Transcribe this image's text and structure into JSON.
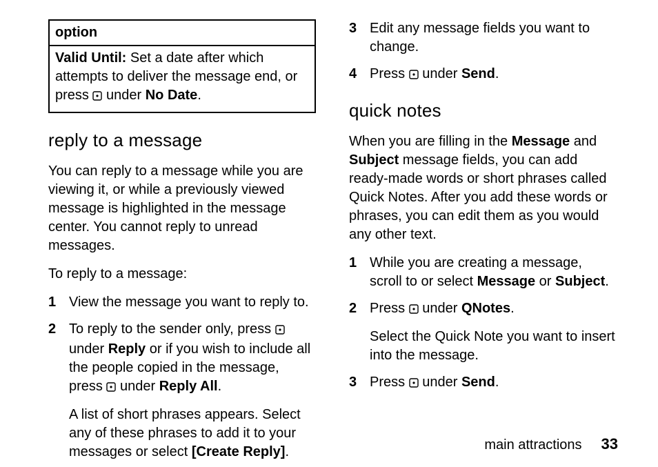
{
  "option": {
    "header": "option",
    "body_label": "Valid Until:",
    "body_text1": " Set a date after which attempts to deliver the message end, or press ",
    "body_text2": " under ",
    "body_nodate": "No Date",
    "body_period": "."
  },
  "left": {
    "heading_reply": "reply to a message",
    "reply_intro": "You can reply to a message while you are viewing it, or while a previously viewed message is highlighted in the message center. You cannot reply to unread messages.",
    "reply_lead": "To reply to a message:",
    "step1_num": "1",
    "step1_text": "View the message you want to reply to.",
    "step2_num": "2",
    "step2_a": "To reply to the sender only, press ",
    "step2_b": " under ",
    "step2_reply": "Reply",
    "step2_c": " or if you wish to include all the people copied in the message, press ",
    "step2_d": " under ",
    "step2_replyall": "Reply All",
    "step2_period": ".",
    "step2_para2a": "A list of short phrases appears. Select any of these phrases to add it to your messages or select ",
    "step2_create": "[Create Reply]",
    "step2_para2b": "."
  },
  "right": {
    "step3_num": "3",
    "step3_text": "Edit any message fields you want to change.",
    "step4_num": "4",
    "step4_a": "Press ",
    "step4_b": " under ",
    "step4_send": "Send",
    "step4_period": ".",
    "heading_quicknotes": "quick notes",
    "qn_intro_a": "When you are filling in the ",
    "qn_message": "Message",
    "qn_intro_b": " and ",
    "qn_subject": "Subject",
    "qn_intro_c": " message fields, you can add ready-made words or short phrases called Quick Notes. After you add these words or phrases, you can edit them as you would any other text.",
    "qn1_num": "1",
    "qn1_a": "While you are creating a message, scroll to or select ",
    "qn1_b": " or ",
    "qn1_period": ".",
    "qn2_num": "2",
    "qn2_a": "Press ",
    "qn2_b": " under ",
    "qn2_qnotes": "QNotes",
    "qn2_period": ".",
    "qn2_para2": "Select the Quick Note you want to insert into the message.",
    "qn3_num": "3",
    "qn3_a": "Press ",
    "qn3_b": " under ",
    "qn3_send": "Send",
    "qn3_period": "."
  },
  "footer": {
    "section": "main attractions",
    "page": "33"
  }
}
